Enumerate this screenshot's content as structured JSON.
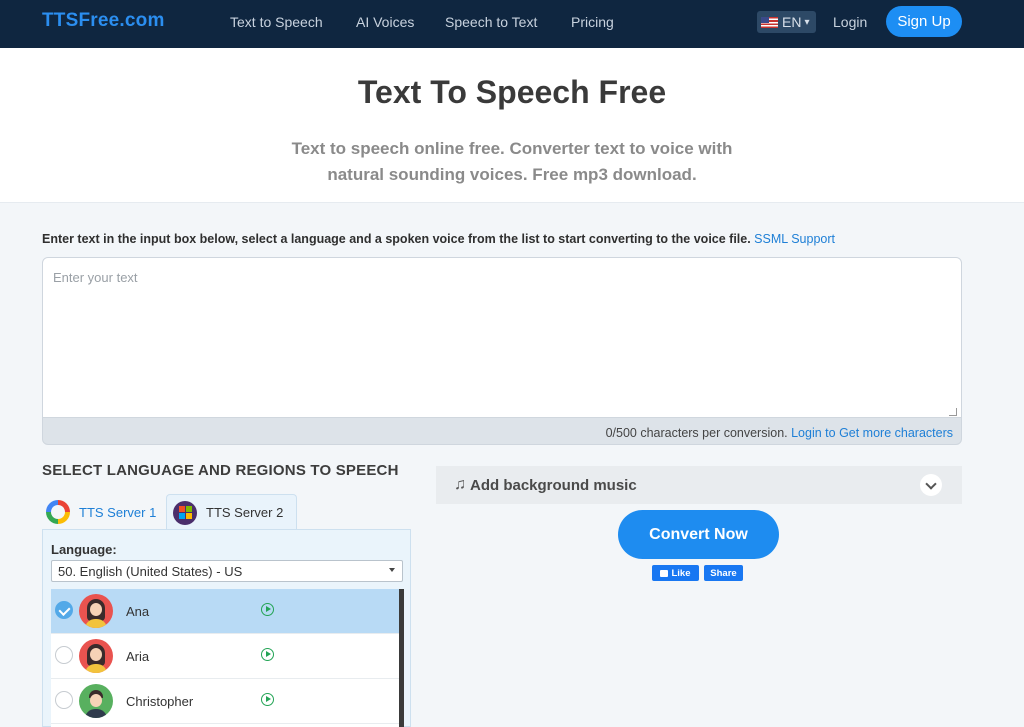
{
  "nav": {
    "logo": "TTSFree.com",
    "links": [
      "Text to Speech",
      "AI Voices",
      "Speech to Text",
      "Pricing"
    ],
    "language": "EN",
    "login": "Login",
    "signup": "Sign Up"
  },
  "hero": {
    "title": "Text To Speech Free",
    "subtitle": "Text to speech online free. Converter text to voice with natural sounding voices. Free mp3 download."
  },
  "instructions": {
    "text": "Enter text in the input box below, select a language and a spoken voice from the list to start converting to the voice file. ",
    "link": "SSML Support"
  },
  "textbox": {
    "placeholder": "Enter your text",
    "value": "",
    "char_count": "0/500 characters per conversion. ",
    "more_link": "Login to Get more characters"
  },
  "select": {
    "heading": "SELECT LANGUAGE AND REGIONS TO SPEECH",
    "tabs": [
      {
        "label": "TTS Server 1",
        "icon": "google-icon",
        "active": false
      },
      {
        "label": "TTS Server 2",
        "icon": "microsoft-icon",
        "active": true
      }
    ],
    "language_label": "Language:",
    "language_value": "50. English (United States) - US",
    "voices": [
      {
        "name": "Ana",
        "selected": true,
        "gender": "female"
      },
      {
        "name": "Aria",
        "selected": false,
        "gender": "female"
      },
      {
        "name": "Christopher",
        "selected": false,
        "gender": "male"
      }
    ]
  },
  "right": {
    "bg_music": "Add background music",
    "convert": "Convert Now",
    "like": "Like",
    "share": "Share"
  },
  "colors": {
    "nav_bg": "#0f2640",
    "accent": "#1e8cf0",
    "selected_row": "#b8daf5"
  }
}
